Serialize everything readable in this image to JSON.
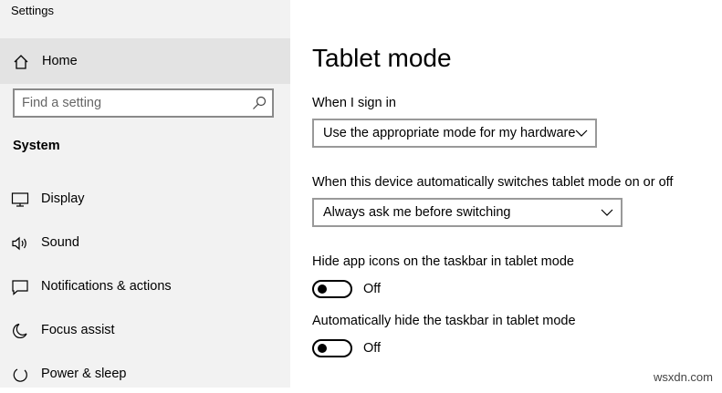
{
  "window": {
    "title": "Settings"
  },
  "sidebar": {
    "home_label": "Home",
    "search_placeholder": "Find a setting",
    "section_title": "System",
    "items": [
      {
        "label": "Display",
        "icon": "display-icon"
      },
      {
        "label": "Sound",
        "icon": "speaker-icon"
      },
      {
        "label": "Notifications & actions",
        "icon": "notification-icon"
      },
      {
        "label": "Focus assist",
        "icon": "moon-icon"
      },
      {
        "label": "Power & sleep",
        "icon": "power-icon"
      }
    ]
  },
  "main": {
    "title": "Tablet mode",
    "sign_in": {
      "label": "When I sign in",
      "selected": "Use the appropriate mode for my hardware"
    },
    "auto_switch": {
      "label": "When this device automatically switches tablet mode on or off",
      "selected": "Always ask me before switching"
    },
    "hide_icons": {
      "label": "Hide app icons on the taskbar in tablet mode",
      "state": "Off"
    },
    "hide_taskbar": {
      "label": "Automatically hide the taskbar in tablet mode",
      "state": "Off"
    }
  },
  "watermark": "wsxdn.com"
}
